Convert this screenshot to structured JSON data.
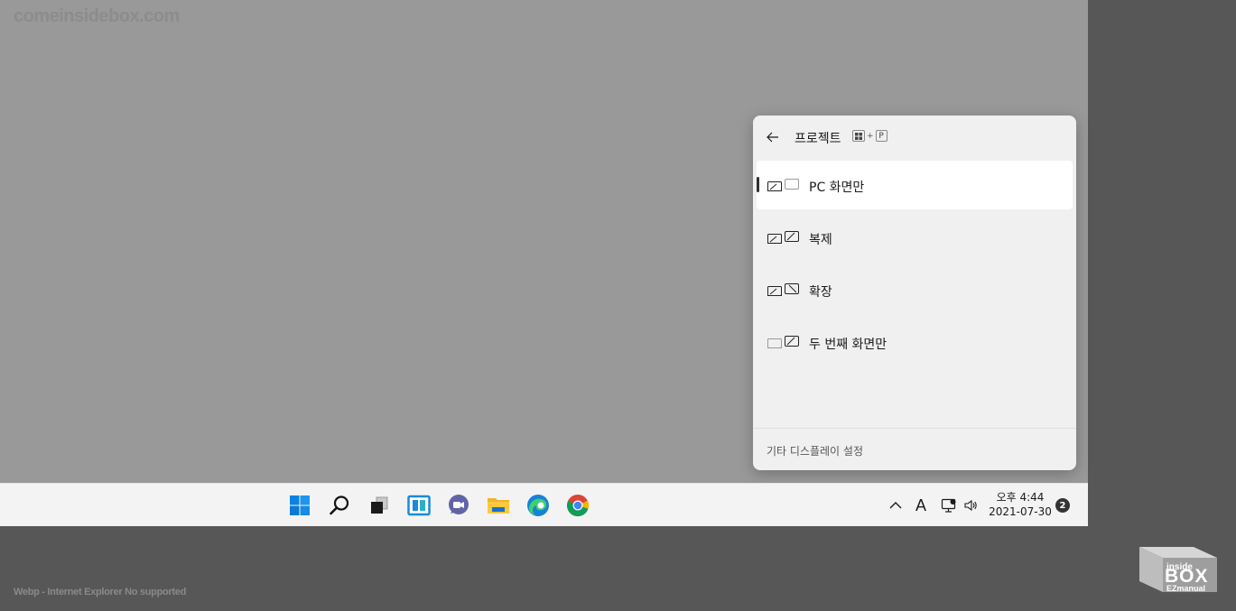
{
  "watermark": {
    "site": "comeinsidebox.com",
    "note": "Webp - Internet Explorer No supported"
  },
  "flyout": {
    "title": "프로젝트",
    "shortcut_plus": "+",
    "shortcut_key": "P",
    "options": [
      {
        "label": "PC 화면만",
        "selected": true
      },
      {
        "label": "복제",
        "selected": false
      },
      {
        "label": "확장",
        "selected": false
      },
      {
        "label": "두 번째 화면만",
        "selected": false
      }
    ],
    "footer_link": "기타 디스플레이 설정"
  },
  "taskbar": {
    "apps": [
      "start-icon",
      "search-icon",
      "task-view-icon",
      "widgets-icon",
      "teams-chat-icon",
      "file-explorer-icon",
      "edge-icon",
      "chrome-icon"
    ],
    "tray": {
      "ime_label": "A"
    },
    "clock": {
      "time": "오후 4:44",
      "date": "2021-07-30"
    },
    "notification_count": "2"
  },
  "logo": {
    "top": "inside",
    "main": "BOX",
    "sub": "EZmanual"
  },
  "colors": {
    "accent_blue": "#0078d4",
    "desktop_gray": "#999999",
    "outer_gray": "#575757"
  }
}
